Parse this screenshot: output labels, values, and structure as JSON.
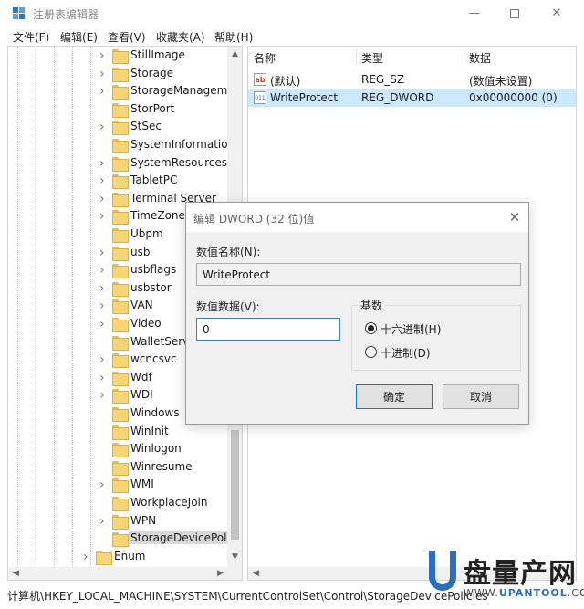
{
  "window": {
    "title": "注册表编辑器",
    "min_glyph": "—",
    "close_glyph": "✕"
  },
  "menu": [
    {
      "label": "文件(F)"
    },
    {
      "label": "编辑(E)"
    },
    {
      "label": "查看(V)"
    },
    {
      "label": "收藏夹(A)"
    },
    {
      "label": "帮助(H)"
    }
  ],
  "tree": {
    "items": [
      {
        "label": "StillImage",
        "expandable": true
      },
      {
        "label": "Storage",
        "expandable": true
      },
      {
        "label": "StorageManagem",
        "expandable": true
      },
      {
        "label": "StorPort",
        "expandable": false
      },
      {
        "label": "StSec",
        "expandable": true
      },
      {
        "label": "SystemInformation",
        "expandable": false
      },
      {
        "label": "SystemResources",
        "expandable": true
      },
      {
        "label": "TabletPC",
        "expandable": true
      },
      {
        "label": "Terminal Server",
        "expandable": true
      },
      {
        "label": "TimeZoneInfo",
        "expandable": true
      },
      {
        "label": "Ubpm",
        "expandable": false
      },
      {
        "label": "usb",
        "expandable": true
      },
      {
        "label": "usbflags",
        "expandable": true
      },
      {
        "label": "usbstor",
        "expandable": true
      },
      {
        "label": "VAN",
        "expandable": true
      },
      {
        "label": "Video",
        "expandable": true
      },
      {
        "label": "WalletService",
        "expandable": false
      },
      {
        "label": "wcncsvc",
        "expandable": true
      },
      {
        "label": "Wdf",
        "expandable": true
      },
      {
        "label": "WDI",
        "expandable": true
      },
      {
        "label": "Windows",
        "expandable": false
      },
      {
        "label": "WinInit",
        "expandable": false
      },
      {
        "label": "Winlogon",
        "expandable": false
      },
      {
        "label": "Winresume",
        "expandable": false
      },
      {
        "label": "WMI",
        "expandable": true
      },
      {
        "label": "WorkplaceJoin",
        "expandable": false
      },
      {
        "label": "WPN",
        "expandable": true
      },
      {
        "label": "StorageDevicePolicies",
        "expandable": false,
        "selected": true
      }
    ],
    "parent_item": {
      "label": "Enum",
      "expandable": true
    }
  },
  "list": {
    "headers": {
      "name": "名称",
      "type": "类型",
      "data": "数据"
    },
    "rows": [
      {
        "icon": "ab",
        "name": "(默认)",
        "type": "REG_SZ",
        "data": "(数值未设置)",
        "selected": false
      },
      {
        "icon": "011",
        "name": "WriteProtect",
        "type": "REG_DWORD",
        "data": "0x00000000 (0)",
        "selected": true
      }
    ]
  },
  "status": {
    "path": "计算机\\HKEY_LOCAL_MACHINE\\SYSTEM\\CurrentControlSet\\Control\\StorageDevicePolicies"
  },
  "dialog": {
    "title": "编辑 DWORD (32 位)值",
    "name_label": "数值名称(N):",
    "name_value": "WriteProtect",
    "data_label": "数值数据(V):",
    "data_value": "0",
    "base_label": "基数",
    "radio_hex": "十六进制(H)",
    "radio_dec": "十进制(D)",
    "selected_base": "hex",
    "ok_label": "确定",
    "cancel_label": "取消",
    "close_glyph": "✕"
  },
  "watermark": {
    "title": "盘量产网",
    "url_prefix": "WWW.",
    "url_brand": "UPANTOOL",
    "url_suffix": ".COM"
  },
  "colors": {
    "selection": "#cce8ff",
    "accent": "#0078d7",
    "folder": "#f6d674"
  }
}
